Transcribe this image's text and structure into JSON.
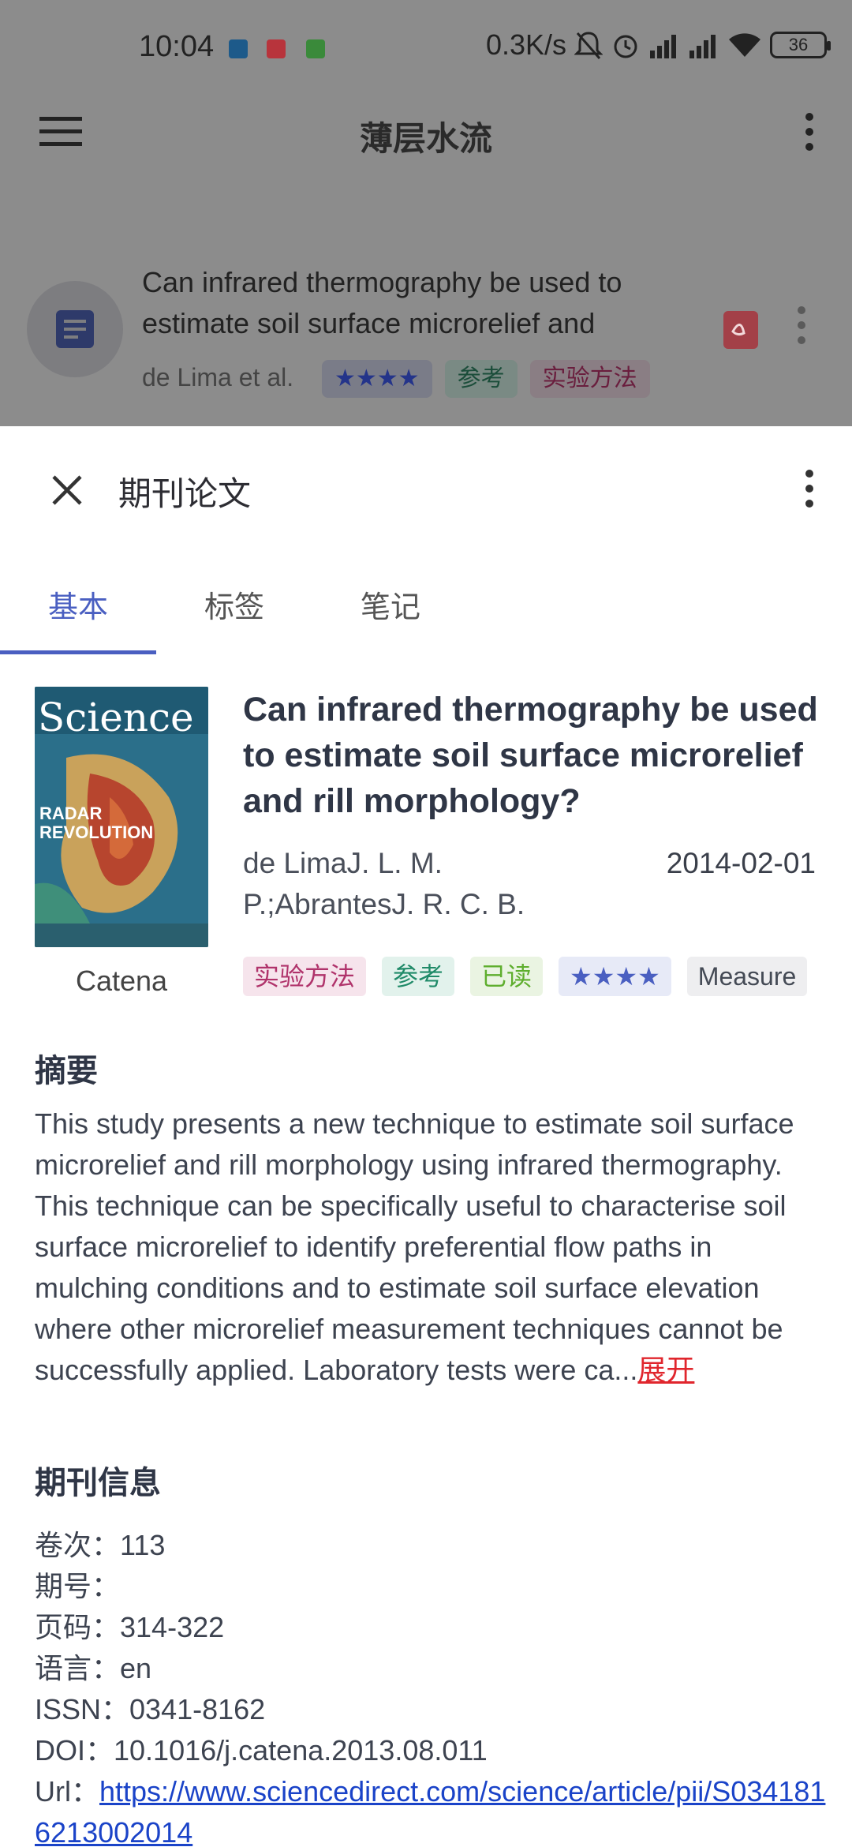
{
  "status_bar": {
    "time": "10:04",
    "net_speed": "0.3K/s",
    "battery": "36"
  },
  "app": {
    "title": "薄层水流"
  },
  "background_item": {
    "title": "Can infrared thermography be used to estimate soil surface microrelief and",
    "authors": "de Lima et al.",
    "chips": [
      {
        "label": "★★★★",
        "color": "#8290c8"
      },
      {
        "label": "参考",
        "color": "#3a7a60"
      },
      {
        "label": "实验方法",
        "color": "#8a3a5a"
      }
    ]
  },
  "sheet": {
    "title": "期刊论文",
    "tabs": [
      "基本",
      "标签",
      "笔记"
    ],
    "active_tab": 0,
    "cover": {
      "masthead": "Science",
      "headline_1": "RADAR",
      "headline_2": "REVOLUTION"
    },
    "journal": "Catena",
    "paper_title": "Can infrared thermography be used to estimate soil surface microrelief and rill morphology?",
    "authors": "de LimaJ. L. M. P.;AbrantesJ. R. C. B.",
    "date": "2014-02-01",
    "chips": [
      {
        "label": "实验方法",
        "fg": "#b0336b",
        "bg": "#f6e4ec"
      },
      {
        "label": "参考",
        "fg": "#1f8a68",
        "bg": "#e2f2ec"
      },
      {
        "label": "已读",
        "fg": "#5fae2e",
        "bg": "#eaf4e2"
      },
      {
        "label": "★★★★",
        "fg": "#4a5fc1",
        "bg": "#e7eaf7"
      },
      {
        "label": "Measure",
        "fg": "#444a55",
        "bg": "#eeeef0"
      }
    ],
    "abstract_heading": "摘要",
    "abstract_text": "This study presents a new technique to estimate soil surface microrelief and rill morphology using infrared thermography. This technique can be specifically useful to characterise soil surface microrelief to identify preferential flow paths in mulching conditions and to estimate soil surface elevation where other microrelief measurement techniques cannot be successfully applied. Laboratory tests were ca...",
    "expand_label": "展开",
    "info_heading": "期刊信息",
    "info": {
      "volume_label": "卷次：",
      "volume": "113",
      "issue_label": "期号：",
      "issue": "",
      "pages_label": "页码：",
      "pages": "314-322",
      "language_label": "语言：",
      "language": "en",
      "issn_label": "ISSN：",
      "issn": "0341-8162",
      "doi_label": "DOI：",
      "doi": "10.1016/j.catena.2013.08.011",
      "url_label": "Url：",
      "url": "https://www.sciencedirect.com/science/article/pii/S0341816213002014"
    }
  }
}
